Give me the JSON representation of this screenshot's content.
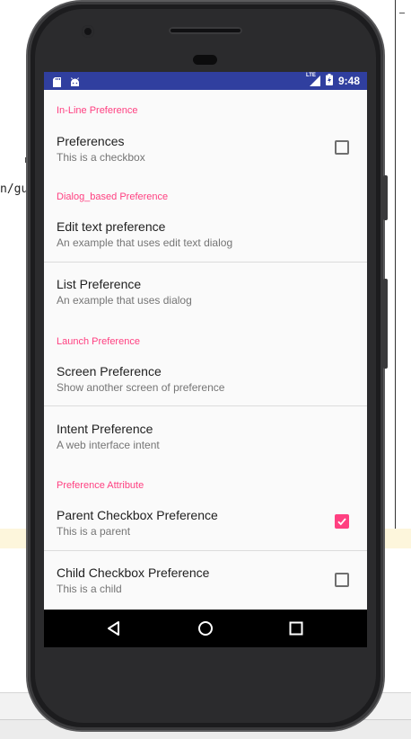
{
  "background": {
    "editor_text_fragment": "n/gu"
  },
  "status_bar": {
    "icons_left": [
      "sd-card-icon",
      "android-icon"
    ],
    "icons_right": [
      "lte-signal-icon",
      "battery-charging-icon"
    ],
    "signal_label": "LTE",
    "time": "9:48",
    "background_color": "#303f9f"
  },
  "preferences": {
    "accent_color": "#ff4081",
    "categories": [
      {
        "title": "In-Line Preference",
        "items": [
          {
            "title": "Preferences",
            "summary": "This is a checkbox",
            "widget": "checkbox",
            "checked": false
          }
        ]
      },
      {
        "title": "Dialog_based Preference",
        "items": [
          {
            "title": "Edit text preference",
            "summary": "An example that uses edit text dialog",
            "widget": "none"
          },
          {
            "title": "List Preference",
            "summary": "An example that uses dialog",
            "widget": "none"
          }
        ]
      },
      {
        "title": "Launch Preference",
        "items": [
          {
            "title": "Screen Preference",
            "summary": "Show another screen of preference",
            "widget": "none"
          },
          {
            "title": "Intent Preference",
            "summary": "A web interface intent",
            "widget": "none"
          }
        ]
      },
      {
        "title": "Preference Attribute",
        "items": [
          {
            "title": "Parent Checkbox Preference",
            "summary": "This is a parent",
            "widget": "checkbox",
            "checked": true
          },
          {
            "title": "Child Checkbox Preference",
            "summary": "This is a child",
            "widget": "checkbox",
            "checked": false
          }
        ]
      }
    ]
  },
  "navigation_bar": {
    "buttons": [
      "back-icon",
      "home-icon",
      "recents-icon"
    ]
  }
}
